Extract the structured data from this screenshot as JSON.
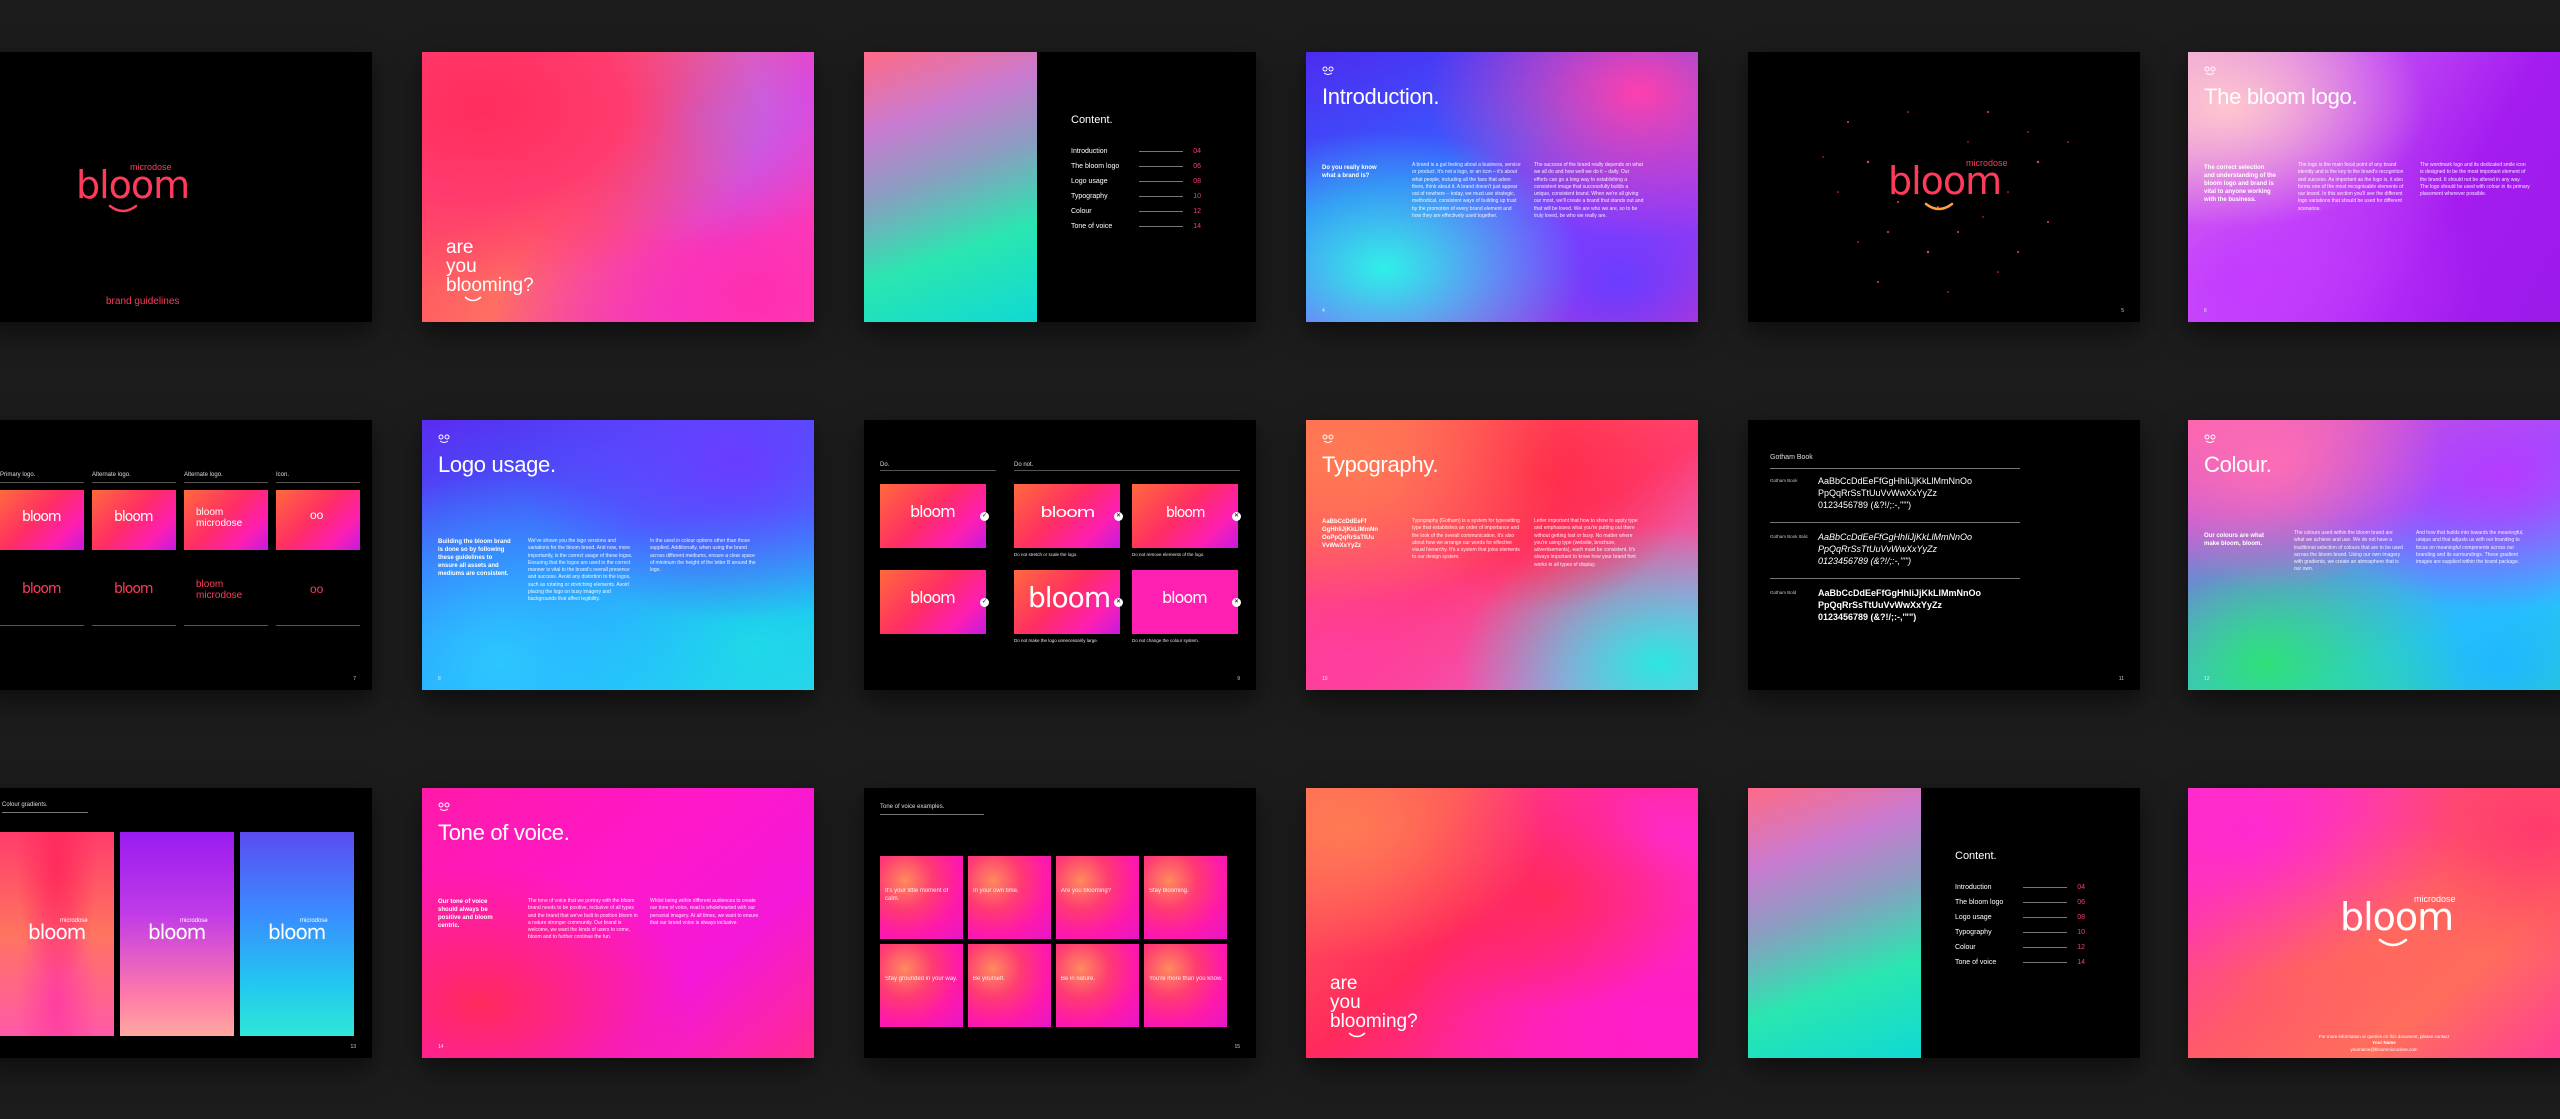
{
  "cover": {
    "micro": "microdose",
    "word": "bloom",
    "footer": "brand guidelines"
  },
  "slide2": {
    "line1": "are",
    "line2": "you",
    "line3": "blooming?"
  },
  "contents": {
    "title": "Content.",
    "items": [
      {
        "label": "Introduction",
        "num": "04"
      },
      {
        "label": "The bloom logo",
        "num": "06"
      },
      {
        "label": "Logo usage",
        "num": "08"
      },
      {
        "label": "Typography",
        "num": "10"
      },
      {
        "label": "Colour",
        "num": "12"
      },
      {
        "label": "Tone of voice",
        "num": "14"
      }
    ]
  },
  "intro": {
    "title": "Introduction.",
    "lead": "Do you really know what a brand is?",
    "col1": "A brand is a gut feeling about a business, service or product. It's not a logo, or an icon – it's about what people, including all the fans that adore them, think about it. A brand doesn't just appear out of nowhere – today, we must use strategic, methodical, consistent ways of building up trust by the promotion of every brand element and how they are effectively used together.",
    "col2": "The success of the brand really depends on what we all do and how well we do it – daily. Our efforts can go a long way to establishing a consistent image that successfully builds a unique, consistent brand. When we're all giving our most, we'll create a brand that stands out and that will be loved. We are who we are, so to be truly loved, be who we really are.",
    "page": "4"
  },
  "starfield": {
    "micro": "microdose",
    "word": "bloom",
    "page": "5"
  },
  "bloomlogo": {
    "title": "The bloom logo.",
    "lead": "The correct selection and understanding of the bloom logo and brand is vital to anyone working with the business.",
    "col1": "The logo is the main focal point of any brand identity and is the key to the brand's recognition and success. As important as the logo is, it also forms one of the most recognisable elements of our brand. In this section you'll see the different logo variations that should be used for different scenarios.",
    "col2": "The wordmark logo and its dedicated smile icon is designed to be the most important element of the brand. It should not be altered in any way. The logo should be used with colour in its primary placement wherever possible.",
    "page": "6"
  },
  "logo_variants": {
    "headers": [
      "Primary logo.",
      "Alternate logo.",
      "Alternate logo.",
      "Icon."
    ],
    "tiles": [
      "bloom",
      "bloom",
      "bloom microdose",
      "oo"
    ],
    "page": "7"
  },
  "logousage": {
    "title": "Logo usage.",
    "lead": "Building the bloom brand is done so by following these guidelines to ensure all assets and mediums are consistent.",
    "col1": "We've shown you the logo versions and variations for the bloom brand. And now, more importantly, is the correct usage of these logos. Ensuring that the logos are used in the correct manner is vital to the brand's overall presence and success. Avoid any distortion to the logos, such as rotating or stretching elements. Avoid placing the logo on busy imagery and backgrounds that affect legibility.",
    "col2": "In the used in colour options other than those supplied. Additionally, when using the brand across different mediums, ensure a clear space of minimum the height of the letter B around the logo.",
    "page": "8"
  },
  "dodont": {
    "do": "Do.",
    "donot": "Do not.",
    "word": "bloom",
    "cap1": "Do not stretch or scale the logo.",
    "cap2": "Do not remove elements of the logo.",
    "cap3": "Do not make the logo unnecessarily large.",
    "cap4": "Do not change the colour system.",
    "page": "9"
  },
  "typography": {
    "title": "Typography.",
    "lead": "AaBbCcDdEeFf GgHhIiJjKkLlMmNn OoPpQqRrSsTtUu VvWwXxYyZz",
    "col1": "Typography (Gotham) is a system for typesetting type that establishes an order of importance and the look of the overall communication. It's also about how we arrange our words for effective visual hierarchy. It's a system that joins elements to our design system.",
    "col2": "Letter important that how to show to apply type and emphasises what you're putting out there without getting lost or busy. No matter where you're using type (website, brochure, advertisements), each must be consistent. It's always important to know how your brand font works in all types of display.",
    "page": "10"
  },
  "fonts": {
    "title": "Gotham Book",
    "labels": [
      "Gotham Book",
      "Gotham Book Italic",
      "Gotham Bold"
    ],
    "line1": "AaBbCcDdEeFfGgHhIiJjKkLlMmNnOo",
    "line2": "PpQqRrSsTtUuVvWwXxYyZz",
    "line3": "0123456789 (&?!/;:-,'\"\")",
    "page": "11"
  },
  "colour": {
    "title": "Colour.",
    "lead": "Our colours are what make bloom, bloom.",
    "col1": "The colours used within the bloom brand are what we achieve and use. We do not have a traditional selection of colours that are to be used across the bloom brand. Using our own imagery with gradients, we create an atmosphere that is our own.",
    "col2": "And how that builds into towards the meaningful, unique and that adjusts us with our branding to focus on meaningful components across our branding and its surroundings. These gradient images are supplied within the brand package.",
    "page": "12"
  },
  "gradients": {
    "title": "Colour gradients.",
    "micro": "microdose",
    "word": "bloom",
    "page": "13"
  },
  "tone": {
    "title": "Tone of voice.",
    "lead": "Our tone of voice should always be positive and bloom centric.",
    "col1": "The tone of voice that we portray with the bloom brand needs to be positive, inclusive of all types and the brand that we've built to position bloom in a nature stronger community. Our brand is welcome, we want the kinds of users to come, bloom and to further continue the fun.",
    "col2": "Whilst being within different audiences to create our tone of voice, read is wholehearted with our personal imagery. At all times, we want to ensure that our brand voice is always inclusive.",
    "page": "14"
  },
  "tone_examples": {
    "title": "Tone of voice examples.",
    "tiles": [
      "It's your little moment of calm.",
      "In your own time.",
      "Are you blooming?",
      "Stay blooming.",
      "Stay grounded in your way.",
      "Be yourself.",
      "Be in nature.",
      "You're more than you know."
    ],
    "page": "15"
  },
  "closing": {
    "line1": "are",
    "line2": "you",
    "line3": "blooming?"
  },
  "closing2": {
    "micro": "microdose",
    "word": "bloom",
    "foot1": "For more information or queries on this document, please contact",
    "foot2": "Your Name",
    "foot3": "yourname@bloommicrodose.com"
  }
}
